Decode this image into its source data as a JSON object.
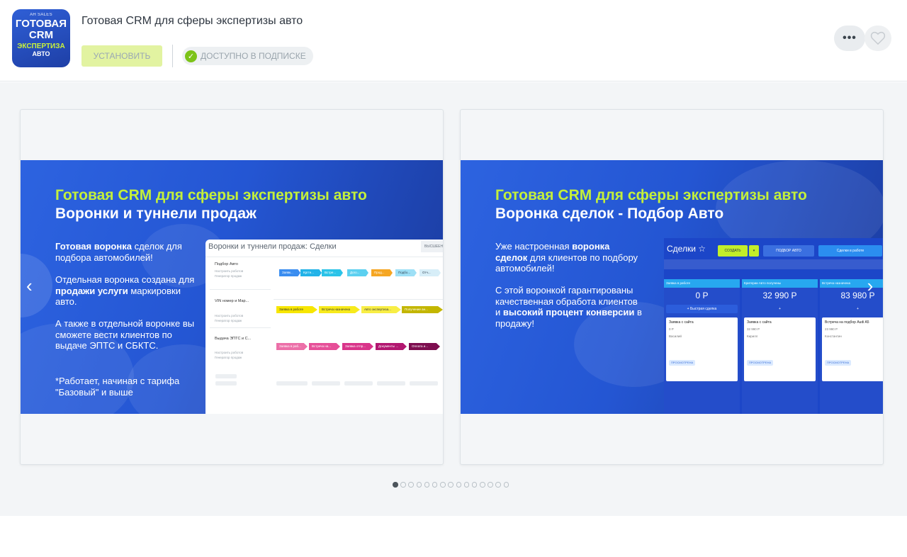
{
  "app": {
    "icon": {
      "brand": "AH SALES",
      "line1": "ГОТОВАЯ",
      "line2": "CRM",
      "line3": "ЭКСПЕРТИЗА",
      "line4": "АВТО",
      "bg_color": "#2a55c8",
      "accent_color": "#c9f23a"
    },
    "title": "Готовая CRM для сферы экспертизы авто",
    "install_label": "УСТАНОВИТЬ",
    "subscription_label": "ДОСТУПНО В ПОДПИСКЕ",
    "more_label": "•••",
    "like_icon": "heart-icon"
  },
  "gallery": {
    "slides": [
      {
        "heading": "Готовая CRM для сферы экспертизы авто",
        "subheading": "Воронки и туннели продаж",
        "p1_bold": "Готовая воронка",
        "p1_rest": " сделок для подбора автомобилей!",
        "p2_pre": "Отдельная воронка создана для ",
        "p2_bold": "продажи услуги",
        "p2_post": " маркировки авто.",
        "p3": "А также в отдельной воронке вы сможете вести клиентов по выдаче ЭПТС и СБКТС.",
        "p4": "*Работает, начиная с тарифа \"Базовый\" и выше",
        "mock": {
          "title": "Воронки и туннели продаж: Сделки",
          "button": "ВЫСШЕЕН",
          "rows": [
            {
              "label": "Подбор Авто",
              "sub1": "Настроить роботов",
              "sub2": "Генератор продаж"
            },
            {
              "label": "VIN номер и Мар...",
              "sub1": "Настроить роботов",
              "sub2": "Генератор продаж"
            },
            {
              "label": "Выдача ЭПТС и С...",
              "sub1": "Настроить роботов",
              "sub2": "Генератор продаж"
            }
          ],
          "row1_tags": [
            "Заявк...",
            "Кргте...",
            "Встре...",
            "Дого...",
            "Прод...",
            "Подбо...",
            "Отч..."
          ],
          "row2_tags": [
            "Заявка в работе",
            "Встреча назначена",
            "Авто экспертиза...",
            "Получение ан..."
          ],
          "row3_tags": [
            "Заявка в раб...",
            "Встреча на...",
            "Заявка отпр...",
            "Документы ...",
            "Оплата и..."
          ]
        }
      },
      {
        "heading": "Готовая CRM для сферы экспертизы авто",
        "subheading": "Воронка сделок - Подбор Авто",
        "p1_pre": "Уже настроенная ",
        "p1_bold": "воронка сделок",
        "p1_rest": " для клиентов по подбору автомобилей!",
        "p2_pre": "С этой воронкой гарантированы качественная обработа клиентов и ",
        "p2_bold": "высокий процент конверсии",
        "p2_post": " в продажу!",
        "mock": {
          "title": "Сделки ☆",
          "create": "СОЗДАТЬ",
          "filter": "ПОДБОР АВТО",
          "search": "Сделки в работе",
          "columns": [
            {
              "head": "Заявка в работе",
              "sum": "0 Р",
              "quick": "+ Быстрая сделка",
              "card_title": "Заявка с сайта",
              "card_sum": "0 Р",
              "card_name": "Василий"
            },
            {
              "head": "Критерии Авто получены",
              "sum": "32 990 Р",
              "quick": "+",
              "card_title": "Заявка с сайта",
              "card_sum": "32 990 Р",
              "card_name": "Кирилл"
            },
            {
              "head": "Встреча назначена",
              "sum": "83 980 Р",
              "quick": "+",
              "card_title": "Встреча на подбор Audi A5",
              "card_sum": "23 990 Р",
              "card_name": "Константин"
            }
          ],
          "pill": "ПРОСМОТРЕНА"
        }
      }
    ],
    "dots_count": 15,
    "active_dot": 0
  }
}
